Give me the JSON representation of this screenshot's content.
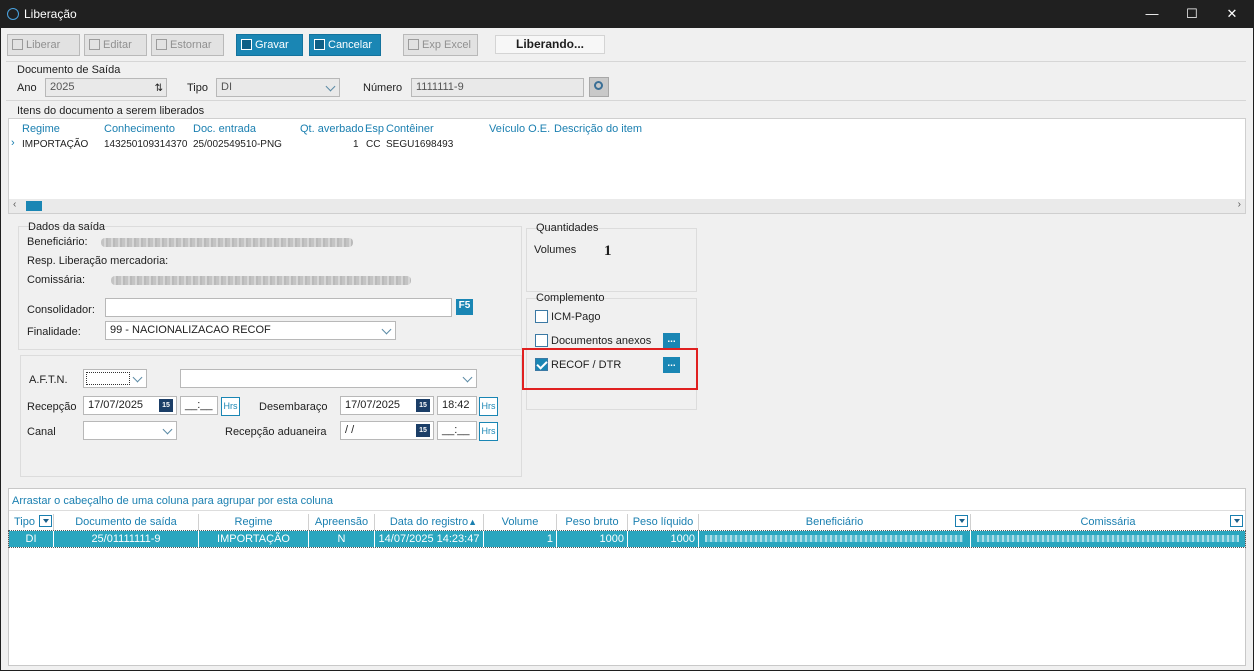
{
  "window": {
    "title": "Liberação",
    "minimize": "—",
    "maximize": "☐",
    "close": "✕"
  },
  "toolbar": {
    "liberar": "Liberar",
    "editar": "Editar",
    "estornar": "Estornar",
    "gravar": "Gravar",
    "cancelar": "Cancelar",
    "exp_excel": "Exp Excel",
    "status": "Liberando..."
  },
  "documento": {
    "group": "Documento de Saída",
    "ano_label": "Ano",
    "ano_value": "2025",
    "tipo_label": "Tipo",
    "tipo_value": "DI",
    "numero_label": "Número",
    "numero_value": "1111111-9"
  },
  "itens": {
    "group": "Itens do documento a serem liberados",
    "columns": [
      "Regime",
      "Conhecimento",
      "Doc. entrada",
      "Qt. averbado",
      "Esp",
      "Contêiner",
      "Veículo O.E.",
      "Descrição do item"
    ],
    "rows": [
      {
        "regime": "IMPORTAÇÃO",
        "conhecimento": "143250109314370",
        "doc_entrada": "25/002549510-PNG",
        "qt": "1",
        "esp": "CC",
        "conteiner": "SEGU1698493",
        "veiculo": "",
        "descricao": ""
      }
    ]
  },
  "dados": {
    "group": "Dados da saída",
    "beneficiario_label": "Beneficiário:",
    "resp_label": "Resp. Liberação mercadoria:",
    "comissaria_label": "Comissária:",
    "consolidador_label": "Consolidador:",
    "consolidador_value": "",
    "f5": "F5",
    "finalidade_label": "Finalidade:",
    "finalidade_value": "99 - NACIONALIZACAO RECOF"
  },
  "aftn": {
    "aftn_label": "A.F.T.N.",
    "recepcao_label": "Recepção",
    "recepcao_date": "17/07/2025",
    "recepcao_time": "__:__",
    "hrs": "Hrs",
    "desembaraco_label": "Desembaraço",
    "desembaraco_date": "17/07/2025",
    "desembaraco_time": "18:42",
    "canal_label": "Canal",
    "recepcao_aduaneira_label": "Recepção aduaneira",
    "recepcao_aduaneira_date": " / /",
    "recepcao_aduaneira_time": "__:__",
    "cal": "15"
  },
  "quantidades": {
    "group": "Quantidades",
    "volumes_label": "Volumes",
    "volumes_value": "1"
  },
  "complemento": {
    "group": "Complemento",
    "icm": {
      "label": "ICM-Pago",
      "checked": false
    },
    "docs": {
      "label": "Documentos anexos",
      "checked": false
    },
    "recof": {
      "label": "RECOF / DTR",
      "checked": true
    },
    "ellipsis": "..."
  },
  "bottom_grid": {
    "group_hint": "Arrastar o cabeçalho de uma coluna para agrupar por esta coluna",
    "columns": [
      "Tipo",
      "Documento de saída",
      "Regime",
      "Apreensão",
      "Data do registro",
      "Volume",
      "Peso bruto",
      "Peso líquido",
      "Beneficiário",
      "Comissária"
    ],
    "rows": [
      {
        "tipo": "DI",
        "doc": "25/01111111-9",
        "regime": "IMPORTAÇÃO",
        "apreensao": "N",
        "data": "14/07/2025 14:23:47",
        "volume": "1",
        "peso_bruto": "1000",
        "peso_liquido": "1000"
      }
    ]
  },
  "colors": {
    "accent": "#1a86b4",
    "highlight": "#e02020",
    "row_selected": "#2aa6bf"
  }
}
